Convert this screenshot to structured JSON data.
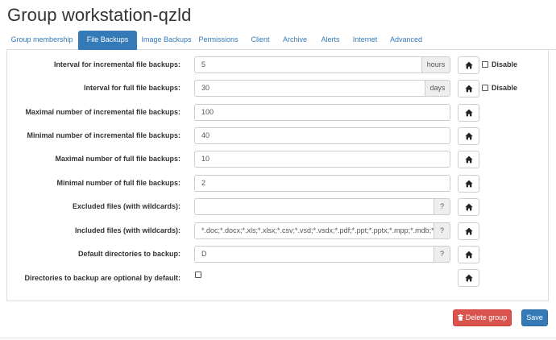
{
  "page": {
    "title": "Group workstation-qzld"
  },
  "tabs": [
    {
      "label": "Group membership",
      "active": false
    },
    {
      "label": "File Backups",
      "active": true
    },
    {
      "label": "Image Backups",
      "active": false
    },
    {
      "label": "Permissions",
      "active": false
    },
    {
      "label": "Client",
      "active": false
    },
    {
      "label": "Archive",
      "active": false
    },
    {
      "label": "Alerts",
      "active": false
    },
    {
      "label": "Internet",
      "active": false
    },
    {
      "label": "Advanced",
      "active": false
    }
  ],
  "settings": [
    {
      "label": "Interval for incremental file backups:",
      "value": "5",
      "unit": "hours",
      "disable_label": "Disable",
      "disabled": false
    },
    {
      "label": "Interval for full file backups:",
      "value": "30",
      "unit": "days",
      "disable_label": "Disable",
      "disabled": false
    },
    {
      "label": "Maximal number of incremental file backups:",
      "value": "100"
    },
    {
      "label": "Minimal number of incremental file backups:",
      "value": "40"
    },
    {
      "label": "Maximal number of full file backups:",
      "value": "10"
    },
    {
      "label": "Minimal number of full file backups:",
      "value": "2"
    },
    {
      "label": "Excluded files (with wildcards):",
      "value": "",
      "help": "?"
    },
    {
      "label": "Included files (with wildcards):",
      "value": "*.doc;*.docx;*.xls;*.xlsx;*.csv;*.vsd;*.vsdx;*.pdf;*.ppt;*.pptx;*.mpp;*.mdb;*.dwg;*.",
      "help": "?"
    },
    {
      "label": "Default directories to backup:",
      "value": "D",
      "help": "?"
    },
    {
      "label": "Directories to backup are optional by default:",
      "checked": false
    }
  ],
  "actions": {
    "delete_label": "Delete group",
    "save_label": "Save"
  },
  "colors": {
    "primary": "#337ab7",
    "danger": "#d9534f",
    "addon_bg": "#eeeeee"
  },
  "icons": {
    "home": "home-icon",
    "delete": "trash-icon"
  }
}
